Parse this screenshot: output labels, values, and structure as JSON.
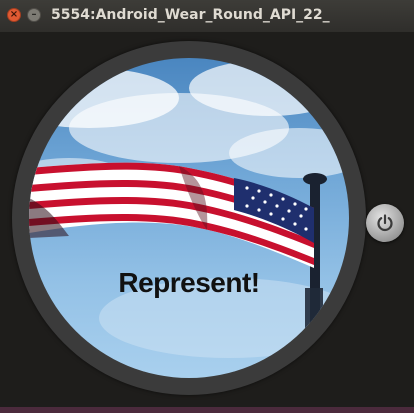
{
  "window": {
    "title": "5554:Android_Wear_Round_API_22_",
    "close_glyph": "×",
    "minimize_glyph": "–"
  },
  "watch": {
    "headline": "Represent!",
    "background_image": "american-flag-on-pole-against-blue-sky"
  },
  "side_button": {
    "icon": "power-icon"
  },
  "colors": {
    "titlebar": "#3a3935",
    "close": "#e05a33",
    "bezel": "#3b3b3b",
    "flag_red": "#c8102e",
    "flag_blue": "#1f2f6e"
  }
}
